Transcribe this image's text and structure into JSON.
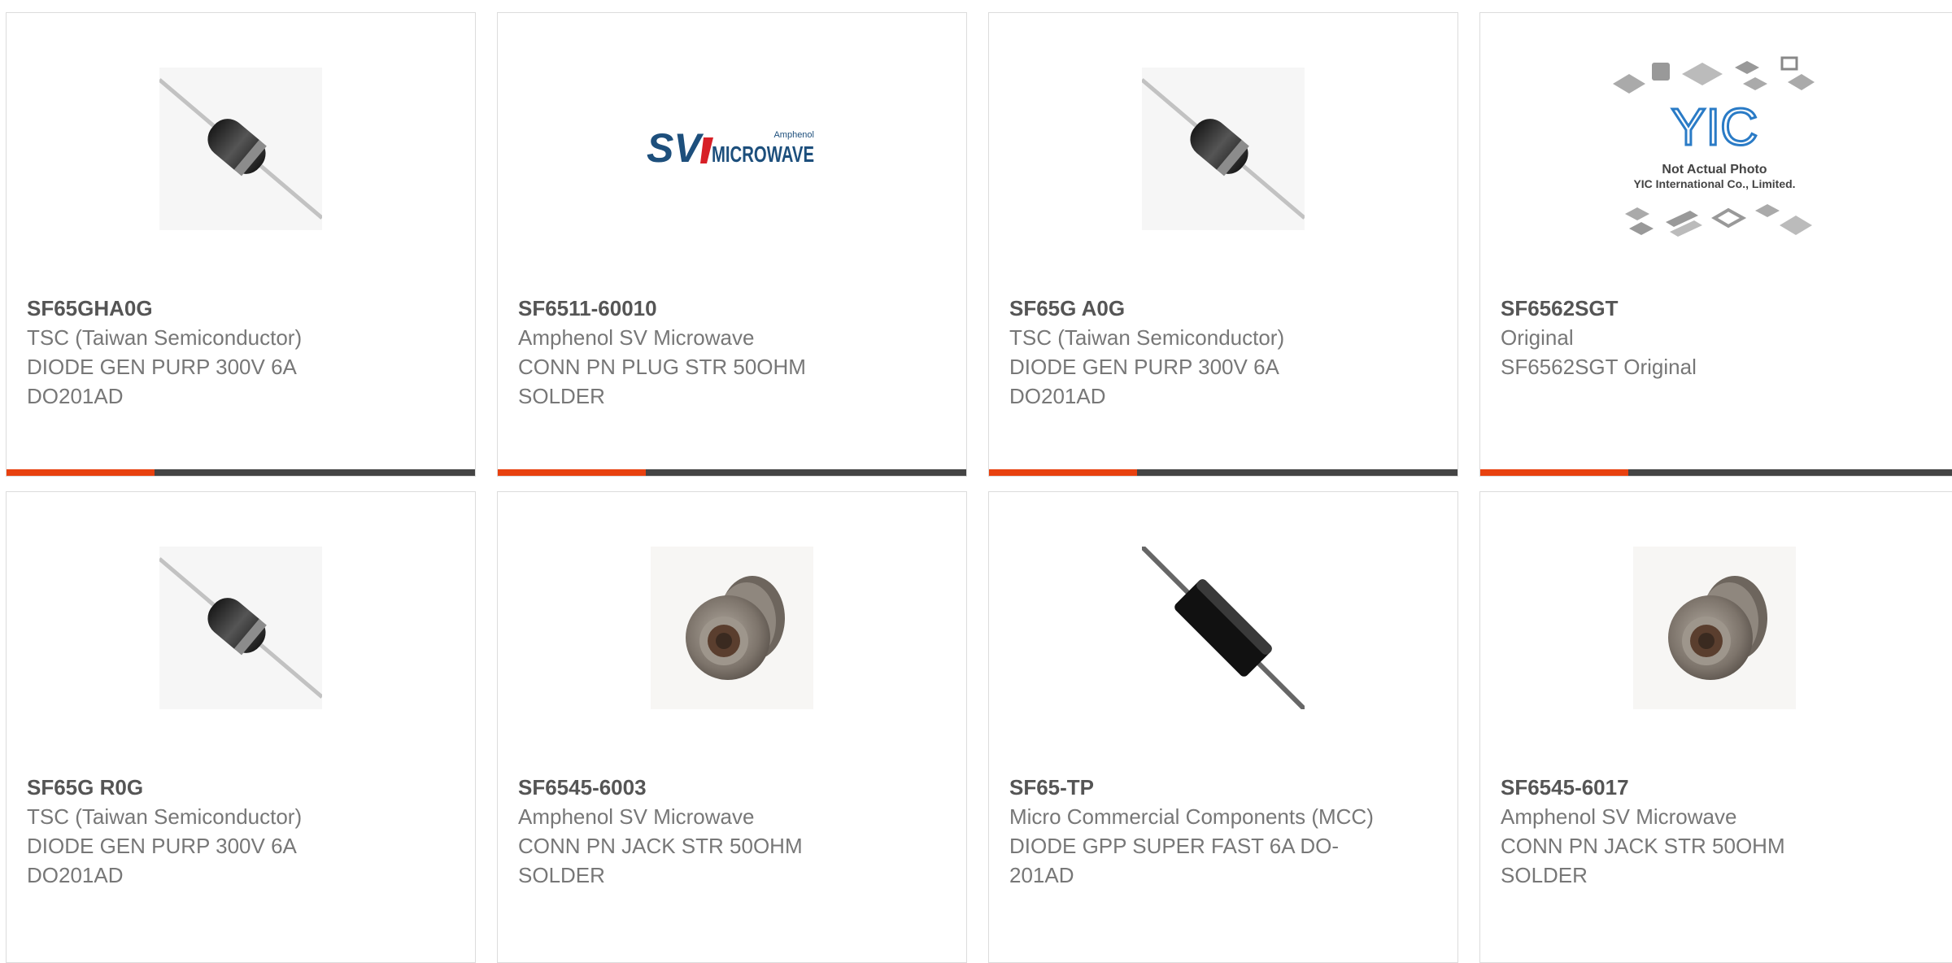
{
  "products": [
    {
      "part_number": "SF65GHA0G",
      "manufacturer": "TSC (Taiwan Semiconductor)",
      "description": "DIODE GEN PURP 300V 6A DO201AD",
      "image": "axial-diode-icon"
    },
    {
      "part_number": "SF6511-60010",
      "manufacturer": "Amphenol SV Microwave",
      "description": "CONN PN PLUG STR 50OHM SOLDER",
      "image": "sv-microwave-logo",
      "logo_text": {
        "sv": "SV",
        "microwave": "MICROWAVE",
        "amphenol": "Amphenol"
      }
    },
    {
      "part_number": "SF65G A0G",
      "manufacturer": "TSC (Taiwan Semiconductor)",
      "description": "DIODE GEN PURP 300V 6A DO201AD",
      "image": "axial-diode-icon"
    },
    {
      "part_number": "SF6562SGT",
      "manufacturer": "Original",
      "description": "SF6562SGT Original",
      "image": "yic-placeholder-image",
      "placeholder_text": {
        "logo": "YIC",
        "line1": "Not Actual Photo",
        "line2": "YIC International Co., Limited."
      }
    },
    {
      "part_number": "SF65G R0G",
      "manufacturer": "TSC (Taiwan Semiconductor)",
      "description": "DIODE GEN PURP 300V 6A DO201AD",
      "image": "axial-diode-icon"
    },
    {
      "part_number": "SF6545-6003",
      "manufacturer": "Amphenol SV Microwave",
      "description": "CONN PN JACK STR 50OHM SOLDER",
      "image": "rf-connector-icon"
    },
    {
      "part_number": "SF65-TP",
      "manufacturer": "Micro Commercial Components (MCC)",
      "description": "DIODE GPP SUPER FAST 6A DO-201AD",
      "image": "black-diode-icon"
    },
    {
      "part_number": "SF6545-6017",
      "manufacturer": "Amphenol SV Microwave",
      "description": "CONN PN JACK STR 50OHM SOLDER",
      "image": "rf-connector-icon"
    }
  ],
  "colors": {
    "accent": "#e8410f",
    "bar_dark": "#444444",
    "part_number": "#555555",
    "text": "#777777",
    "border": "#dcdcdc"
  }
}
